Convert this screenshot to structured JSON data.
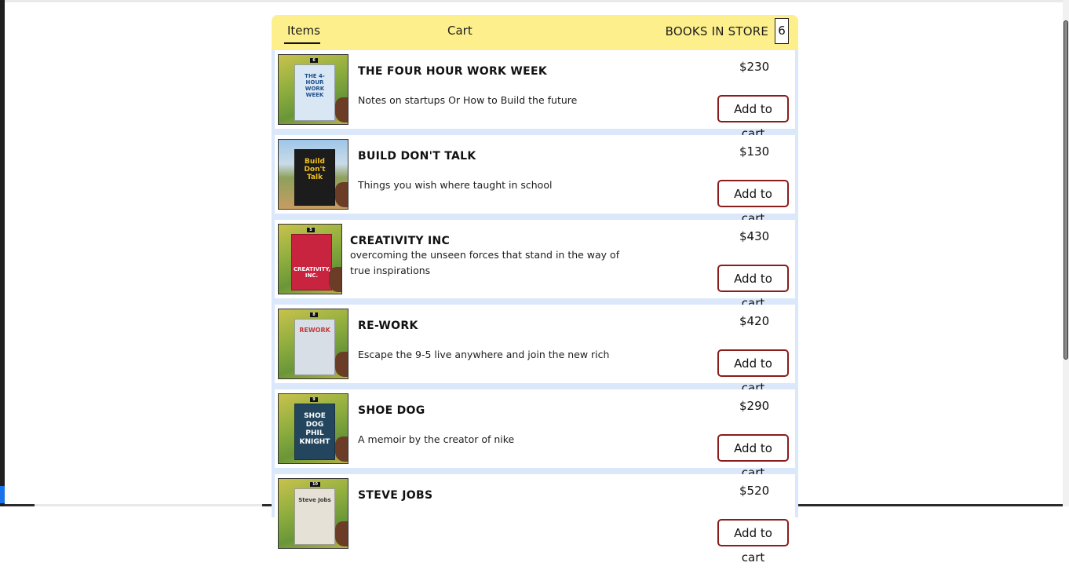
{
  "nav": {
    "items_tab": "Items",
    "cart_tab": "Cart",
    "store_label": "BOOKS IN STORE",
    "store_count": "6"
  },
  "books": [
    {
      "title": "THE FOUR HOUR WORK WEEK",
      "description": "Notes on startups Or How to Build the future",
      "price": "$230",
      "button": "Add to cart",
      "cover_text": "THE 4-HOUR WORK WEEK",
      "cover_color": "#d9e6f3",
      "badge": "6"
    },
    {
      "title": "BUILD DON'T TALK",
      "description": "Things you wish where taught in school",
      "price": "$130",
      "button": "Add to cart",
      "cover_text": "Build Don't Talk",
      "cover_color": "#1c1c1c",
      "badge": ""
    },
    {
      "title": "CREATIVITY INC",
      "description": "overcoming the unseen forces that stand in the way of true inspirations",
      "price": "$430",
      "button": "Add to cart",
      "cover_text": "CREATIVITY, INC.",
      "cover_color": "#c8233f",
      "badge": "5"
    },
    {
      "title": "RE-WORK",
      "description": "Escape the 9-5 live anywhere and join the new rich",
      "price": "$420",
      "button": "Add to cart",
      "cover_text": "REWORK",
      "cover_color": "#d8dee6",
      "badge": "8"
    },
    {
      "title": "SHOE DOG",
      "description": "A memoir by the creator of nike",
      "price": "$290",
      "button": "Add to cart",
      "cover_text": "SHOE DOG PHIL KNIGHT",
      "cover_color": "#23465e",
      "badge": "9"
    },
    {
      "title": "STEVE JOBS",
      "description": "",
      "price": "$520",
      "button": "Add to cart",
      "cover_text": "Steve Jobs",
      "cover_color": "#e5e1d6",
      "badge": "10"
    }
  ]
}
